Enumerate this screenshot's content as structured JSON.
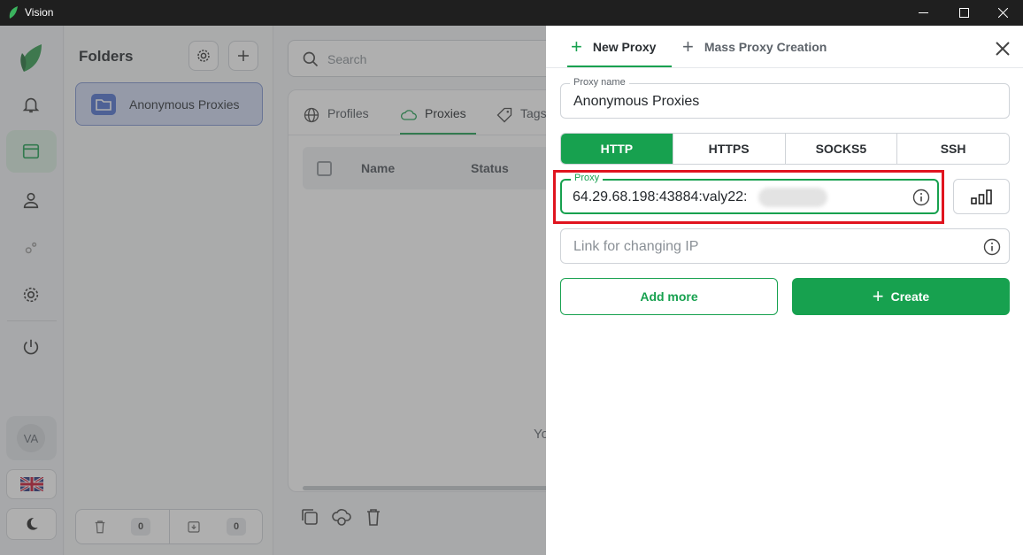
{
  "window": {
    "title": "Vision"
  },
  "folders": {
    "title": "Folders",
    "items": [
      {
        "label": "Anonymous Proxies"
      }
    ],
    "footer": {
      "trash_count": "0",
      "archive_count": "0"
    }
  },
  "rail": {
    "avatar_initials": "VA"
  },
  "main": {
    "search_placeholder": "Search",
    "tabs": [
      {
        "label": "Profiles"
      },
      {
        "label": "Proxies"
      },
      {
        "label": "Tags"
      }
    ],
    "columns": [
      "Name",
      "Status"
    ],
    "empty_text_partial": "Yo"
  },
  "drawer": {
    "tabs": [
      {
        "label": "New Proxy",
        "active": true
      },
      {
        "label": "Mass Proxy Creation",
        "active": false
      }
    ],
    "proxy_name": {
      "label": "Proxy name",
      "value": "Anonymous Proxies"
    },
    "protocols": [
      "HTTP",
      "HTTPS",
      "SOCKS5",
      "SSH"
    ],
    "selected_protocol": "HTTP",
    "proxy": {
      "label": "Proxy",
      "value": "64.29.68.198:43884:valy22:"
    },
    "change_ip": {
      "placeholder": "Link for changing IP"
    },
    "add_more_label": "Add more",
    "create_label": "Create"
  },
  "colors": {
    "accent": "#17a14f",
    "highlight": "#e0141f",
    "folder_accent": "#4c6fd0"
  }
}
